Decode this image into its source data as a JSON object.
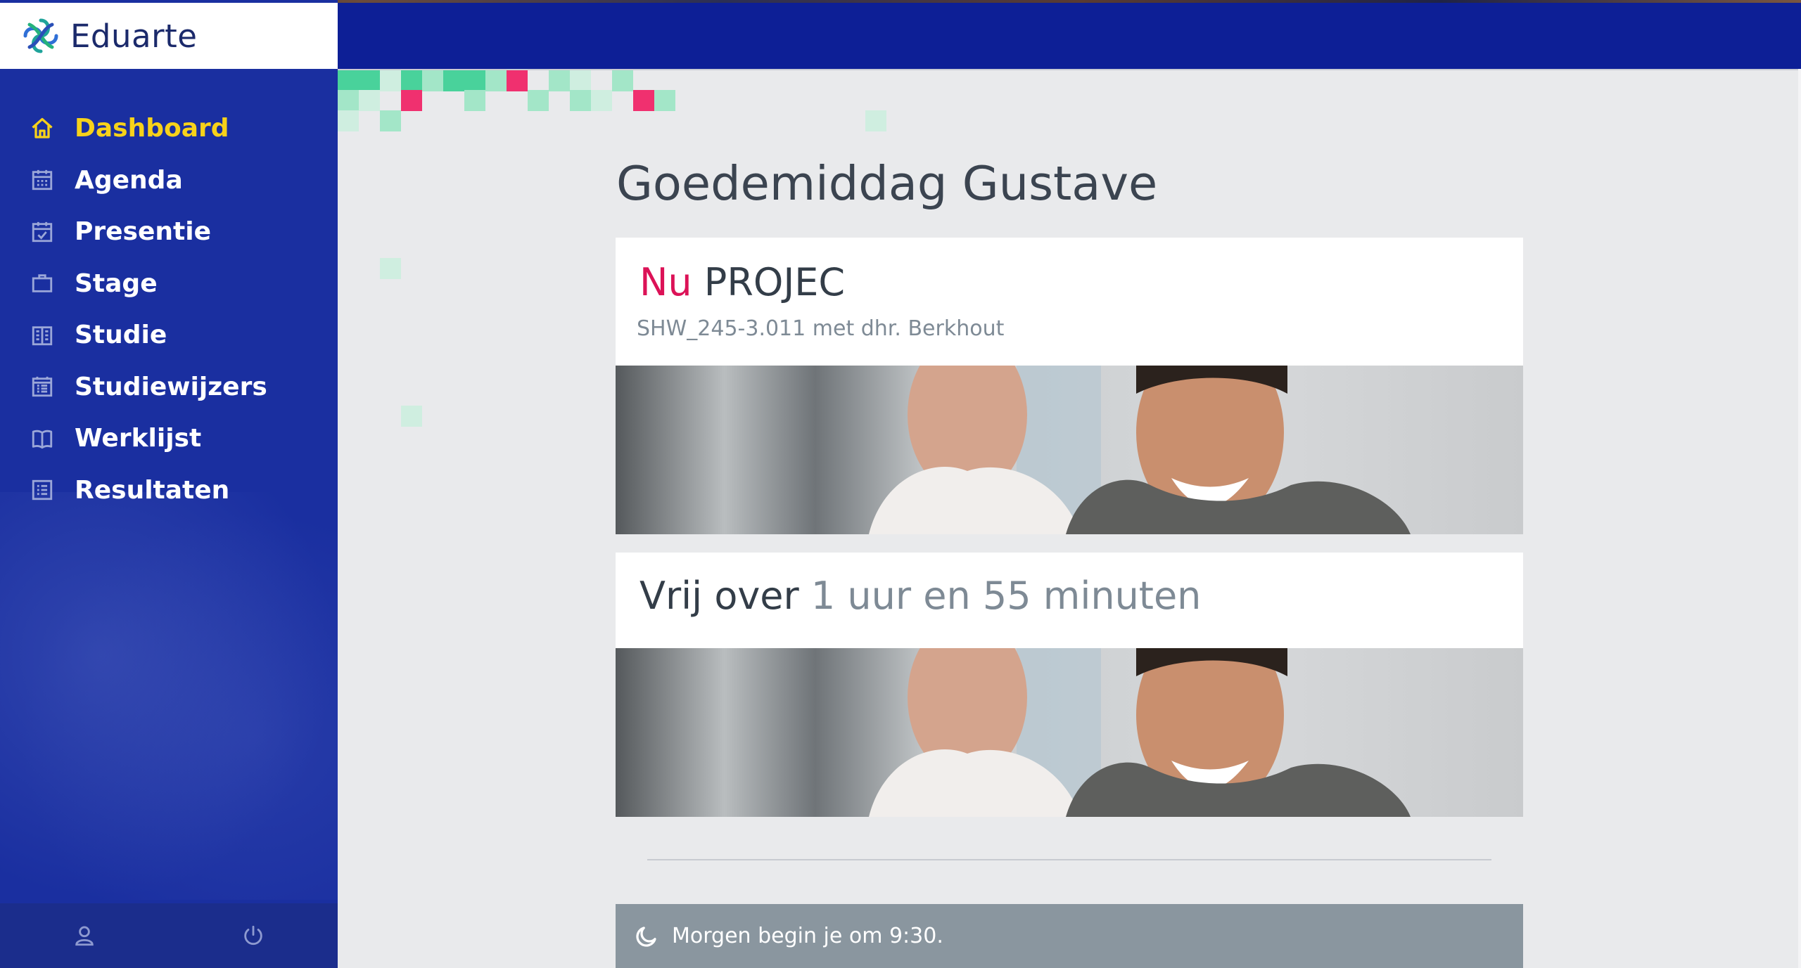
{
  "app": {
    "name": "Eduarte",
    "logo_icon": "eduarte-logo-icon"
  },
  "sidebar": {
    "items": [
      {
        "label": "Dashboard",
        "icon": "home-icon",
        "active": true
      },
      {
        "label": "Agenda",
        "icon": "calendar-icon",
        "active": false
      },
      {
        "label": "Presentie",
        "icon": "calendar-check-icon",
        "active": false
      },
      {
        "label": "Stage",
        "icon": "briefcase-icon",
        "active": false
      },
      {
        "label": "Studie",
        "icon": "building-icon",
        "active": false
      },
      {
        "label": "Studiewijzers",
        "icon": "list-calendar-icon",
        "active": false
      },
      {
        "label": "Werklijst",
        "icon": "book-icon",
        "active": false
      },
      {
        "label": "Resultaten",
        "icon": "results-list-icon",
        "active": false
      }
    ],
    "footer": {
      "profile_icon": "user-icon",
      "logout_icon": "power-icon"
    }
  },
  "main": {
    "greeting": "Goedemiddag Gustave",
    "current": {
      "prefix": "Nu",
      "title": "PROJEC",
      "subtitle": "SHW_245-3.011 met dhr. Berkhout"
    },
    "free": {
      "prefix": "Vrij over",
      "time": "1 uur en 55 minuten"
    },
    "notice": {
      "icon": "moon-icon",
      "text": "Morgen begin je om 9:30."
    }
  },
  "colors": {
    "sidebar": "#1a2fa0",
    "header": "#0d1f96",
    "active_nav": "#f7d21a",
    "accent_now": "#dc1257",
    "pixel_green": "#49d29b",
    "pixel_pink": "#f0306f"
  }
}
